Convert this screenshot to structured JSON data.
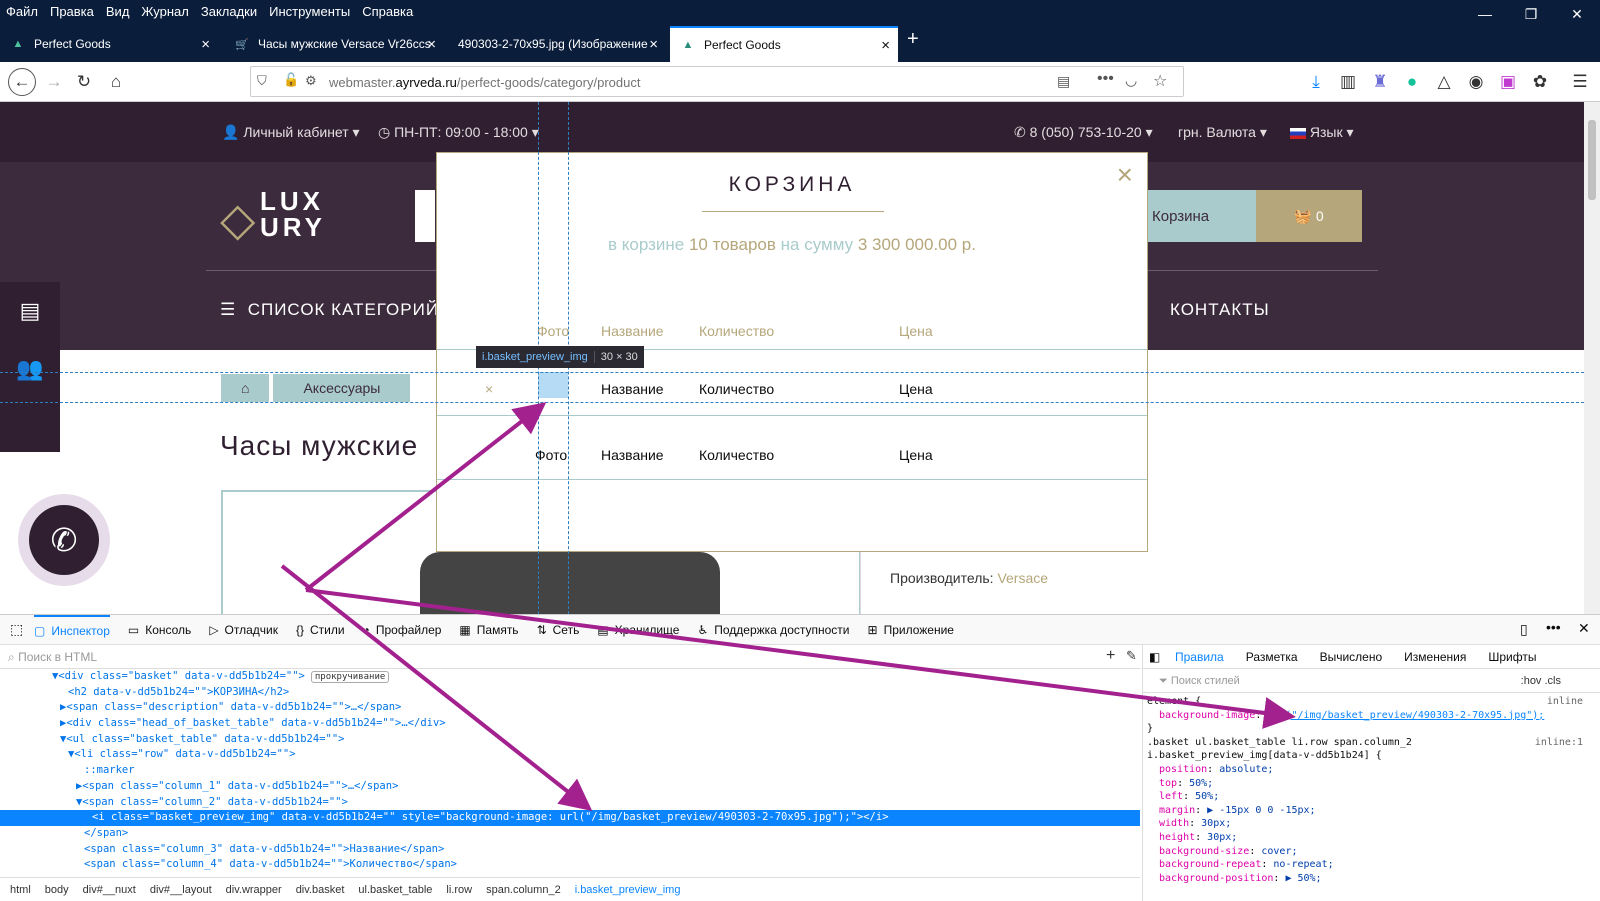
{
  "menubar": {
    "items": [
      "Файл",
      "Правка",
      "Вид",
      "Журнал",
      "Закладки",
      "Инструменты",
      "Справка"
    ]
  },
  "window": {
    "minimize": "—",
    "restore": "❐",
    "close": "✕"
  },
  "tabs": [
    {
      "title": "Perfect Goods",
      "icon": "triangle-logo-icon"
    },
    {
      "title": "Часы мужские Versace Vr26ccs",
      "icon": "cart-icon"
    },
    {
      "title": "490303-2-70x95.jpg (Изображение",
      "icon": "none"
    },
    {
      "title": "Perfect Goods",
      "icon": "triangle-logo-icon",
      "active": true
    }
  ],
  "newtab": "+",
  "url": {
    "prefix": "webmaster.",
    "domain": "ayrveda.ru",
    "path": "/perfect-goods/category/product"
  },
  "site": {
    "account": "Личный кабинет",
    "hours": "ПН-ПТ: 09:00 - 18:00",
    "phone": "8 (050) 753-10-20",
    "currency": "грн. Валюта",
    "language": "Язык",
    "logo_top": "LUX",
    "logo_bottom": "URY",
    "cart_label": "Корзина",
    "cart_count": "0",
    "categories": "СПИСОК КАТЕГОРИЙ",
    "contacts": "КОНТАКТЫ",
    "breadcrumb": [
      "Аксессуары"
    ],
    "title": "Часы мужские",
    "maker_label": "Производитель:",
    "maker_value": "Versace"
  },
  "modal": {
    "title": "КОРЗИНА",
    "close": "×",
    "summary_a": "в корзине",
    "summary_b": "10 товаров",
    "summary_c": "на сумму",
    "summary_d": "3 300 000.00 р.",
    "head": {
      "photo": "Фото",
      "name": "Название",
      "qty": "Количество",
      "price": "Цена"
    },
    "row1": {
      "remove": "×",
      "name": "Название",
      "qty": "Количество",
      "price": "Цена"
    },
    "row2": {
      "photo": "Фото",
      "name": "Название",
      "qty": "Количество",
      "price": "Цена"
    }
  },
  "tooltip": {
    "name": "i.basket_preview_img",
    "dims": "30 × 30"
  },
  "devtools": {
    "tabs": [
      "Инспектор",
      "Консоль",
      "Отладчик",
      "Стили",
      "Профайлер",
      "Память",
      "Сеть",
      "Хранилище",
      "Поддержка доступности",
      "Приложение"
    ],
    "search_placeholder": "Поиск в HTML",
    "html_lines": [
      {
        "indent": 6,
        "text": "▼<div class=\"basket\" data-v-dd5b1b24=\"\">",
        "badge": "прокручивание"
      },
      {
        "indent": 8,
        "text": "<h2 data-v-dd5b1b24=\"\">КОРЗИНА</h2>"
      },
      {
        "indent": 7,
        "text": "▶<span class=\"description\" data-v-dd5b1b24=\"\">…</span>"
      },
      {
        "indent": 7,
        "text": "▶<div class=\"head_of_basket_table\" data-v-dd5b1b24=\"\">…</div>"
      },
      {
        "indent": 7,
        "text": "▼<ul class=\"basket_table\" data-v-dd5b1b24=\"\">"
      },
      {
        "indent": 8,
        "text": "▼<li class=\"row\" data-v-dd5b1b24=\"\">"
      },
      {
        "indent": 10,
        "text": "::marker"
      },
      {
        "indent": 9,
        "text": "▶<span class=\"column_1\" data-v-dd5b1b24=\"\">…</span>"
      },
      {
        "indent": 9,
        "text": "▼<span class=\"column_2\" data-v-dd5b1b24=\"\">"
      },
      {
        "indent": 11,
        "text": "<i class=\"basket_preview_img\" data-v-dd5b1b24=\"\" style=\"background-image: url(\"/img/basket_preview/490303-2-70x95.jpg\");\"></i>",
        "selected": true
      },
      {
        "indent": 10,
        "text": "</span>"
      },
      {
        "indent": 10,
        "text": "<span class=\"column_3\" data-v-dd5b1b24=\"\">Название</span>"
      },
      {
        "indent": 10,
        "text": "<span class=\"column_4\" data-v-dd5b1b24=\"\">Количество</span>"
      }
    ],
    "crumbs": [
      "html",
      "body",
      "div#__nuxt",
      "div#__layout",
      "div.wrapper",
      "div.basket",
      "ul.basket_table",
      "li.row",
      "span.column_2",
      "i.basket_preview_img"
    ],
    "rule_tabs": [
      "Правила",
      "Разметка",
      "Вычислено",
      "Изменения",
      "Шрифты"
    ],
    "filter_placeholder": "Поиск стилей",
    "filter_right": ":hov  .cls",
    "rules": [
      {
        "text": "element {",
        "src": "inline"
      },
      {
        "prop": "background-image",
        "val": "url(\"/img/basket_preview/490303-2-70x95.jpg\");"
      },
      {
        "text": "}"
      },
      {
        "text": ".basket ul.basket_table li.row span.column_2",
        "src": "inline:1"
      },
      {
        "text": "i.basket_preview_img[data-v-dd5b1b24] {"
      },
      {
        "prop": "position",
        "val": "absolute;"
      },
      {
        "prop": "top",
        "val": "50%;"
      },
      {
        "prop": "left",
        "val": "50%;"
      },
      {
        "prop": "margin",
        "val": "▶ -15px 0 0 -15px;"
      },
      {
        "prop": "width",
        "val": "30px;"
      },
      {
        "prop": "height",
        "val": "30px;"
      },
      {
        "prop": "background-size",
        "val": "cover;"
      },
      {
        "prop": "background-repeat",
        "val": "no-repeat;"
      },
      {
        "prop": "background-position",
        "val": "▶ 50%;"
      }
    ]
  },
  "colors": {
    "accent": "#0a84ff",
    "site_dark": "#2f1f30",
    "gold": "#b5a77b",
    "teal": "#a9cbcb",
    "arrow": "#a3218f"
  }
}
